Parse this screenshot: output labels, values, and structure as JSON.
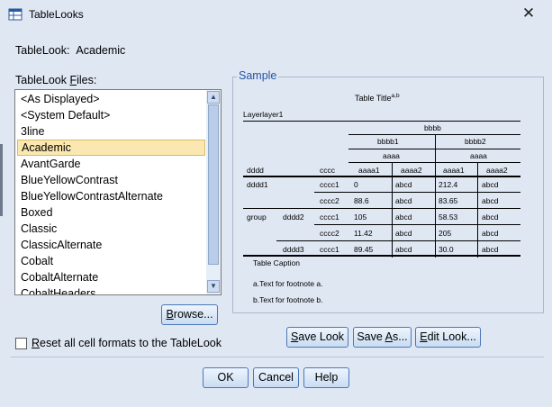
{
  "window": {
    "title": "TableLooks",
    "close_glyph": "✕"
  },
  "tablelook": {
    "label": "TableLook:",
    "value": "Academic"
  },
  "files": {
    "label_prefix": "TableLook ",
    "label_accel": "F",
    "label_suffix": "iles:",
    "items": [
      "<As Displayed>",
      "<System Default>",
      "3line",
      "Academic",
      "AvantGarde",
      "BlueYellowContrast",
      "BlueYellowContrastAlternate",
      "Boxed",
      "Classic",
      "ClassicAlternate",
      "Cobalt",
      "CobaltAlternate",
      "CobaltHeaders"
    ],
    "selected_index": 3
  },
  "buttons": {
    "browse": "Browse...",
    "save_look": "Save Look",
    "save_as": "Save As...",
    "edit_look": "Edit Look...",
    "ok": "OK",
    "cancel": "Cancel",
    "help": "Help"
  },
  "reset": {
    "label": "Reset all cell formats to the TableLook",
    "checked": false
  },
  "sample": {
    "group_title": "Sample",
    "table_title": "Table Title",
    "title_superscript": "a,b",
    "layer": "Layerlayer1",
    "headers": {
      "bbbb": "bbbb",
      "bbbb1": "bbbb1",
      "bbbb2": "bbbb2",
      "aaaa": "aaaa",
      "aaaa1": "aaaa1",
      "aaaa2": "aaaa2",
      "dddd": "dddd",
      "cccc": "cccc"
    },
    "rows": [
      {
        "l1": "dddd1",
        "l2": "",
        "l3": "cccc1",
        "v": [
          "0",
          "abcd",
          "212.4",
          "abcd"
        ]
      },
      {
        "l1": "",
        "l2": "",
        "l3": "cccc2",
        "v": [
          "88.6",
          "abcd",
          "83.65",
          "abcd"
        ]
      },
      {
        "l1": "group",
        "l2": "dddd2",
        "l3": "cccc1",
        "v": [
          "105",
          "abcd",
          "58.53",
          "abcd"
        ]
      },
      {
        "l1": "",
        "l2": "",
        "l3": "cccc2",
        "v": [
          "11.42",
          "abcd",
          "205",
          "abcd"
        ]
      },
      {
        "l1": "",
        "l2": "dddd3",
        "l3": "cccc1",
        "v": [
          "89.45",
          "abcd",
          "30.0",
          "abcd"
        ]
      }
    ],
    "caption": "Table Caption",
    "footnotes": [
      "a.Text for footnote a.",
      "b.Text for footnote b."
    ]
  }
}
